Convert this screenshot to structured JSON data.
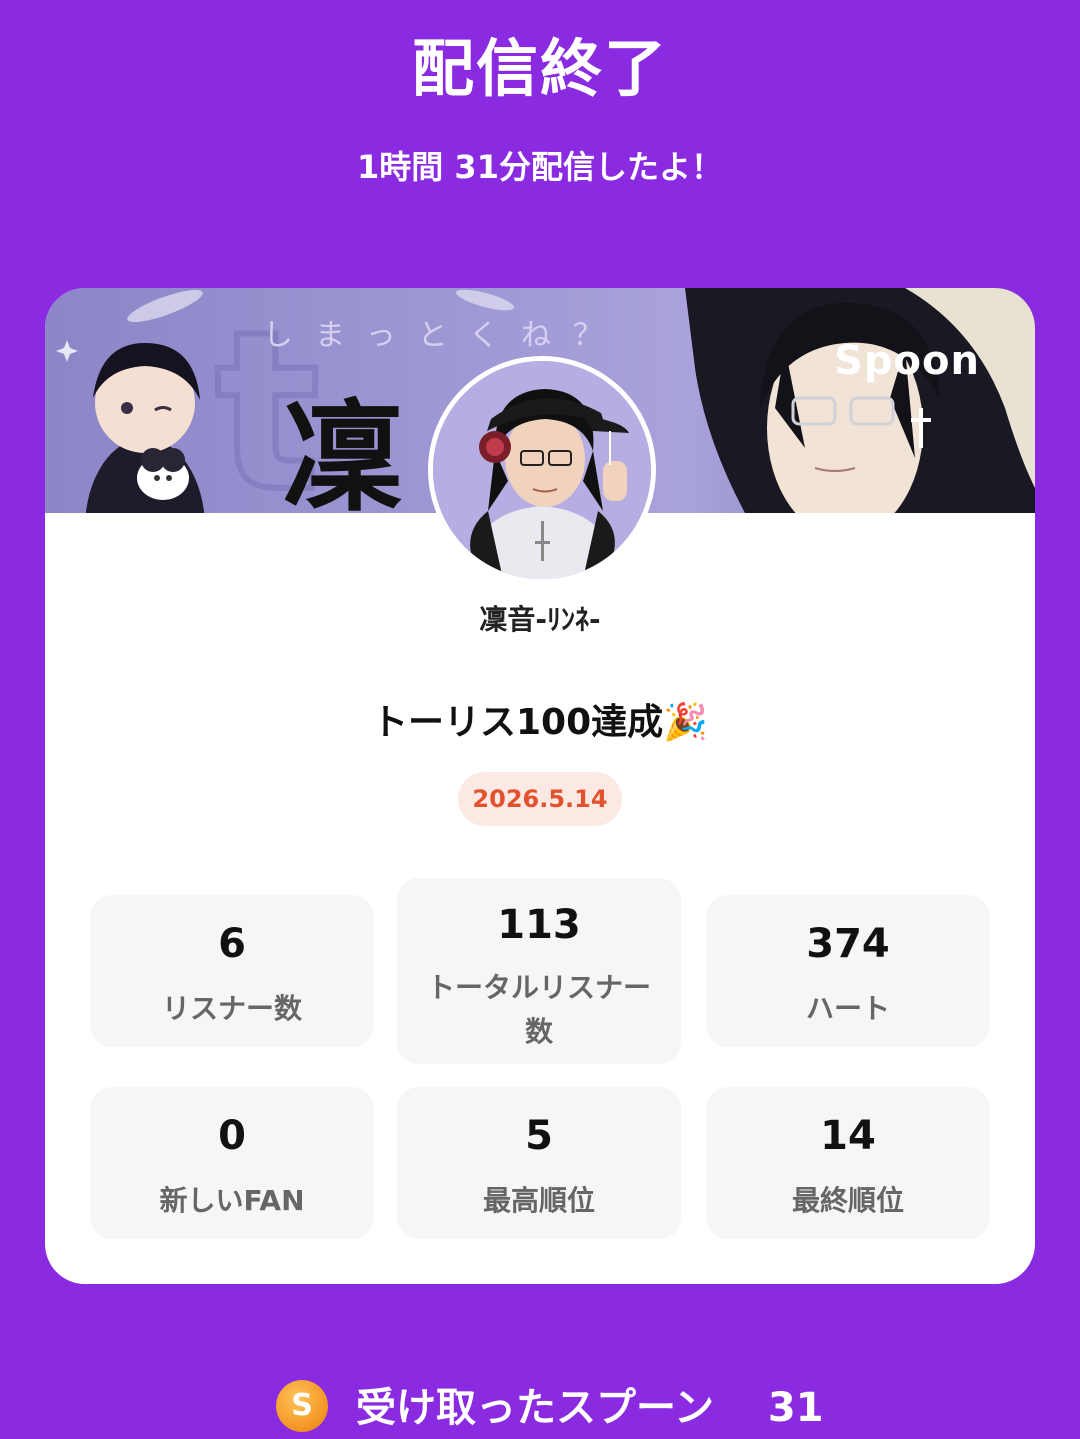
{
  "header": {
    "title": "配信終了",
    "subtitle": "1時間 31分配信したよ！"
  },
  "banner": {
    "kanji": "凜",
    "caption": "しまっとくね？",
    "logo": "Spoon"
  },
  "profile": {
    "username": "凜音-ﾘﾝﾈ-",
    "live_title": "トーリス100達成🎉",
    "date": "2026.5.14"
  },
  "stats": [
    {
      "value": "6",
      "label": "リスナー数"
    },
    {
      "value": "113",
      "label": "トータルリスナー数"
    },
    {
      "value": "374",
      "label": "ハート"
    },
    {
      "value": "0",
      "label": "新しいFAN"
    },
    {
      "value": "5",
      "label": "最高順位"
    },
    {
      "value": "14",
      "label": "最終順位"
    }
  ],
  "spoons": {
    "coin_letter": "S",
    "label": "受け取ったスプーン",
    "count": "31",
    "icon": "spoon-coin-icon"
  },
  "colors": {
    "background": "#8A2BE2",
    "card": "#FFFFFF",
    "stat_bg": "#F6F6F6",
    "date_text": "#E2522F",
    "date_bg": "#FCE9E3"
  }
}
